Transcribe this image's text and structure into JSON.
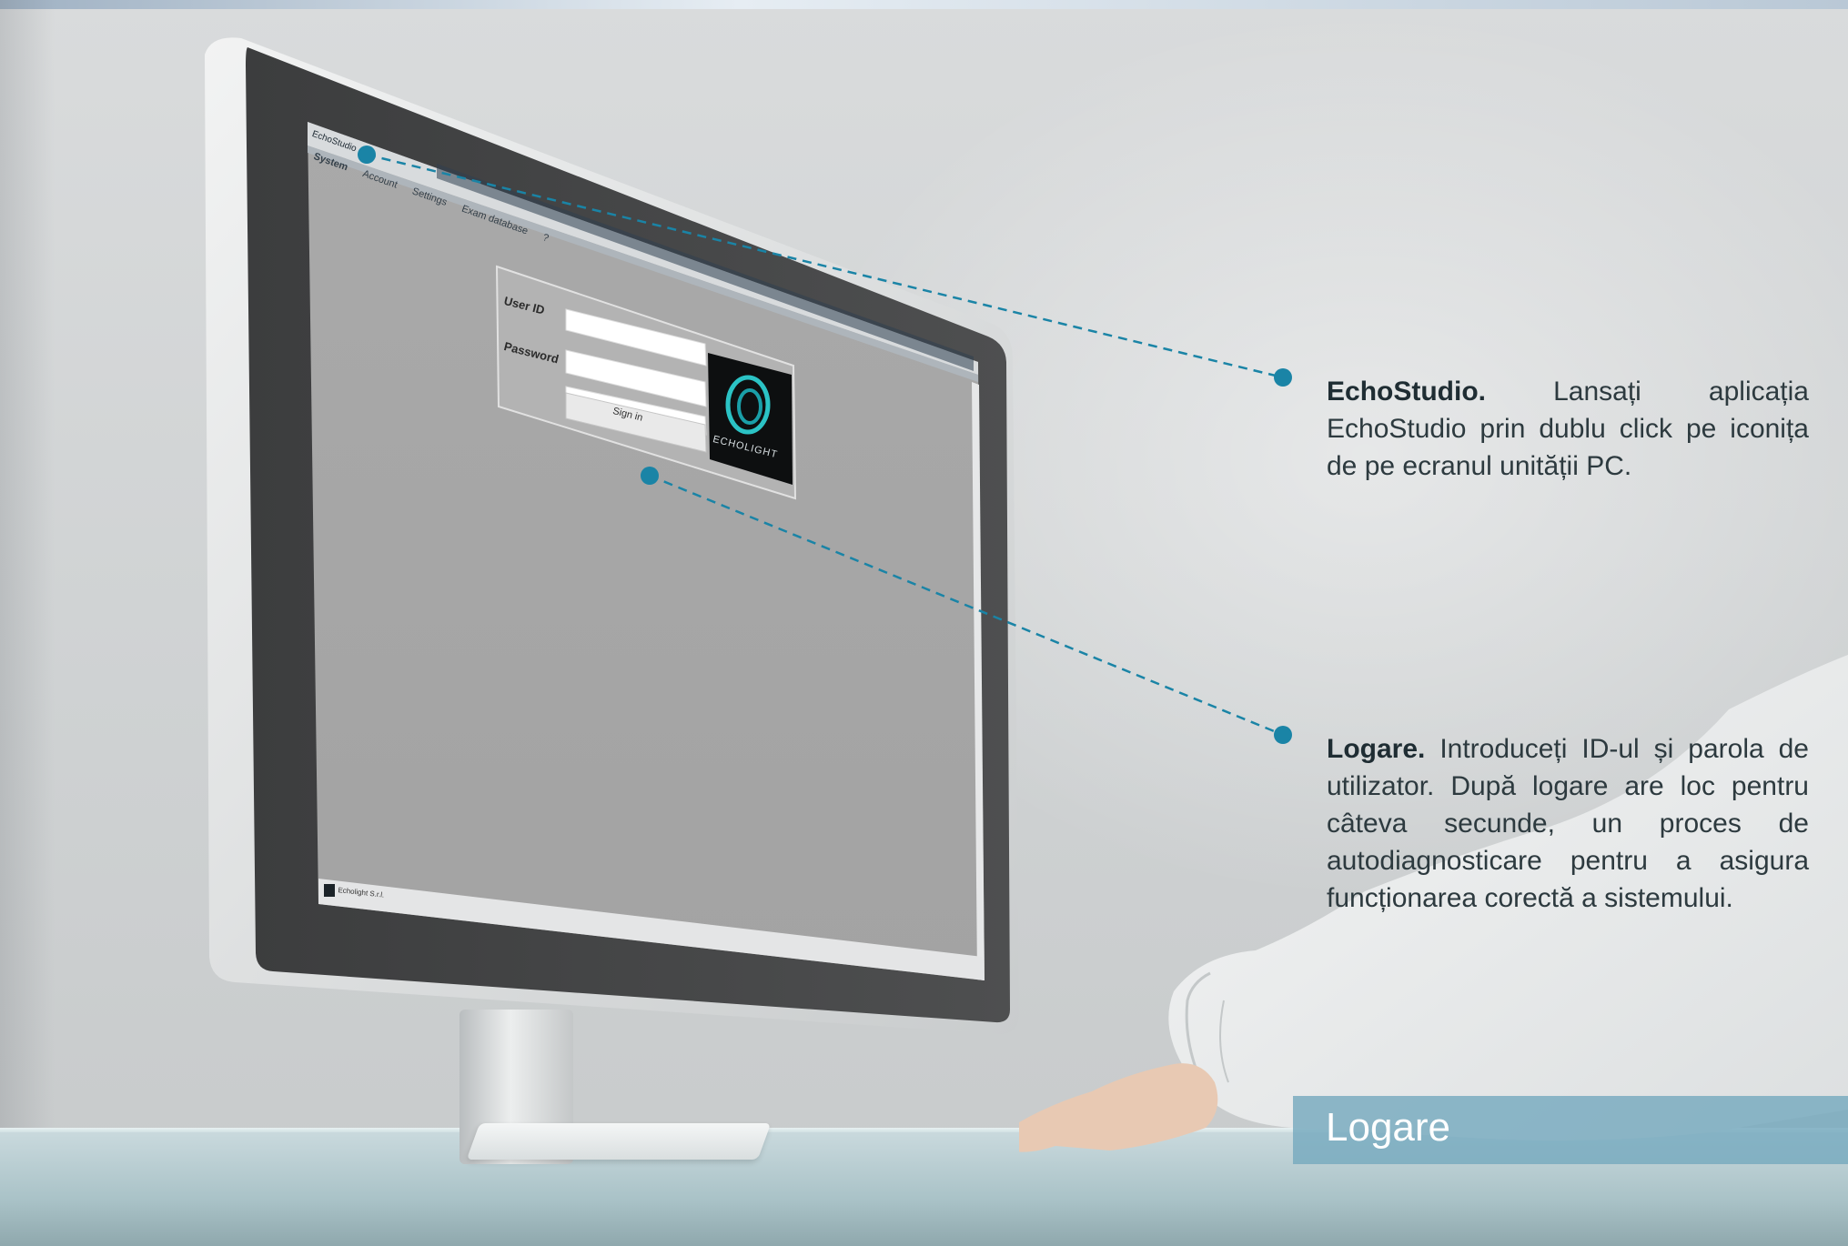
{
  "app": {
    "window_title": "EchoStudio",
    "menu": [
      "System",
      "Account",
      "Settings",
      "Exam database",
      "?"
    ],
    "login": {
      "user_id_label": "User ID",
      "password_label": "Password",
      "sign_in_button": "Sign in",
      "logo_text": "ECHOLIGHT"
    },
    "status_text": "Echolight S.r.l."
  },
  "callouts": [
    {
      "title": "EchoStudio.",
      "body": "Lansați aplicația EchoStudio prin dublu click pe iconița de pe ecranul unității PC."
    },
    {
      "title": "Logare.",
      "body": "Introduceți ID-ul și parola de utilizator. După logare are loc pentru câteva secunde, un proces de autodiagnosticare  pentru a asigura funcționarea corectă a sistemului."
    }
  ],
  "section_title": "Logare",
  "colors": {
    "accent": "#1a84a6",
    "banner": "#76aabe",
    "app_background": "#a6a6a6"
  }
}
